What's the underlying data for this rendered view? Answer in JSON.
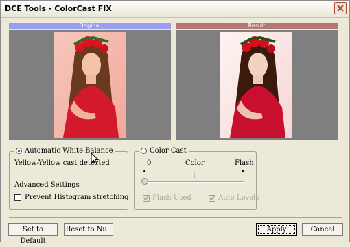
{
  "window": {
    "title": "DCE Tools - ColorCast FIX"
  },
  "panels": {
    "original_label": "Original",
    "result_label": "Result"
  },
  "awb": {
    "label": "Automatic White Balance",
    "selected": true,
    "status": "Yellow-Yellow cast detected",
    "advanced_title": "Advanced Settings",
    "prevent_hist_label": "Prevent Histogram stretching",
    "prevent_hist_checked": false
  },
  "color_cast": {
    "label": "Color Cast",
    "selected": false,
    "scale_min": "0",
    "scale_mid": "Color",
    "scale_max": "Flash",
    "slider_value": 0,
    "flash_used_label": "Flash Used",
    "flash_used_checked": true,
    "auto_levels_label": "Auto Levels",
    "auto_levels_checked": true
  },
  "buttons": {
    "set_default": "Set to Default",
    "reset_null": "Reset to Null",
    "apply": "Apply",
    "cancel": "Cancel"
  },
  "colors": {
    "original_header": "#9a9ef0",
    "result_header": "#b87575",
    "dress": "#c8102e"
  },
  "icons": {
    "close": "close-icon",
    "cursor": "mouse-pointer-icon"
  }
}
